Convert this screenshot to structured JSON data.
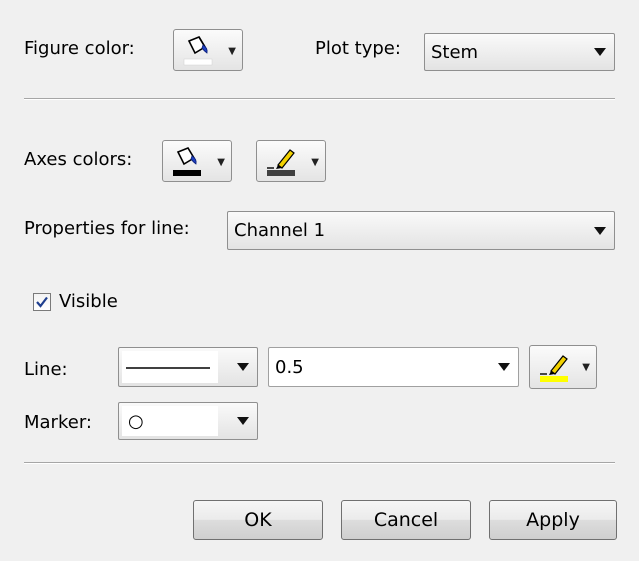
{
  "figure_color": {
    "label": "Figure color:",
    "fill_icon": "paint-bucket-icon"
  },
  "plot_type": {
    "label": "Plot type:",
    "value": "Stem"
  },
  "axes_colors": {
    "label": "Axes colors:",
    "fill_icon": "paint-bucket-icon",
    "line_icon": "pen-icon",
    "fill_color": "#000000",
    "line_color": "#404040"
  },
  "line_properties": {
    "label": "Properties for line:",
    "value": "Channel 1"
  },
  "visible": {
    "label": "Visible",
    "checked": true
  },
  "line": {
    "label": "Line:",
    "width_value": "0.5",
    "line_icon": "pen-icon",
    "color": "#ffff00"
  },
  "marker": {
    "label": "Marker:",
    "symbol": "○"
  },
  "buttons": {
    "ok": "OK",
    "cancel": "Cancel",
    "apply": "Apply"
  }
}
